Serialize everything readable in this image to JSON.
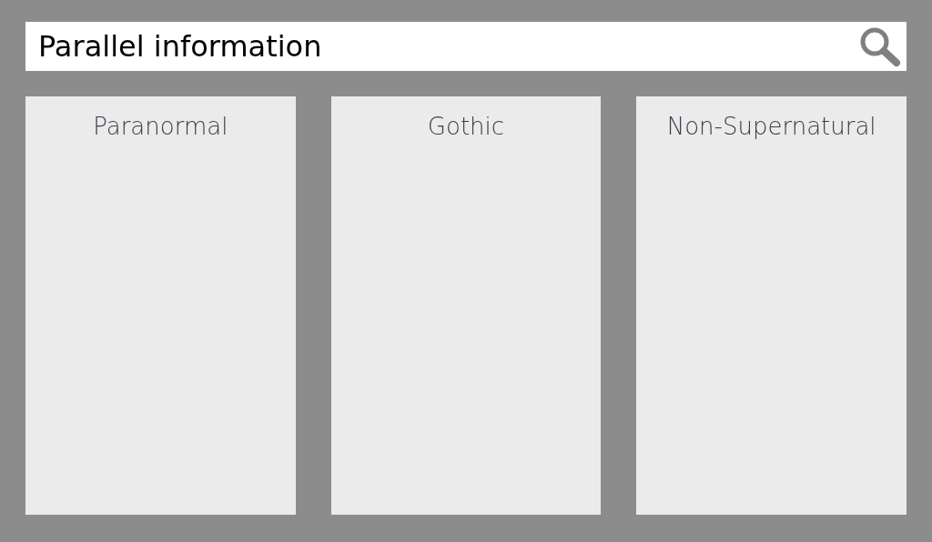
{
  "search": {
    "value": "Parallel information"
  },
  "panels": [
    {
      "title": "Paranormal"
    },
    {
      "title": "Gothic"
    },
    {
      "title": "Non-Supernatural"
    }
  ]
}
